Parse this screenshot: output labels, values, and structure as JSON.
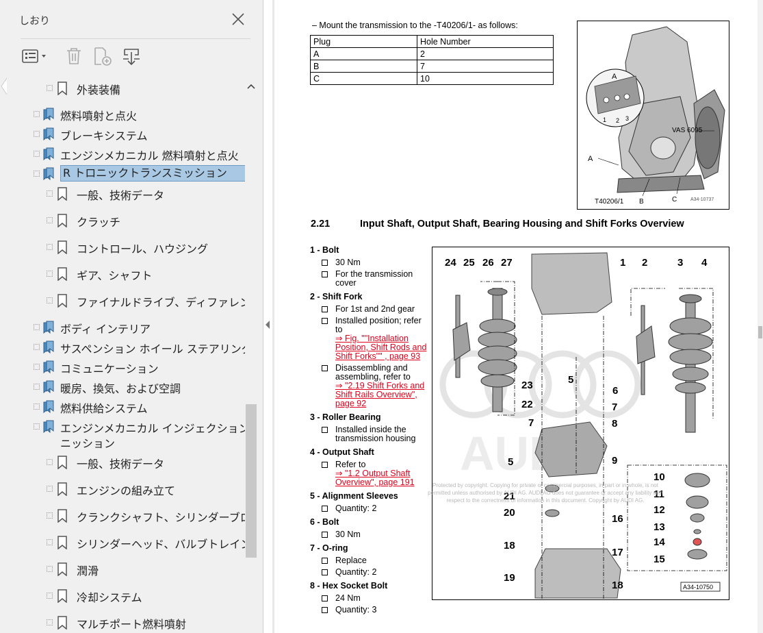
{
  "panel": {
    "title": "しおり",
    "toolbar": [
      "options",
      "delete",
      "new-bookmark",
      "expand"
    ],
    "tree": [
      {
        "label": "外装装備",
        "level": 2,
        "icon": "bookmark"
      },
      {
        "label": "燃料噴射と点火",
        "level": 1,
        "icon": "bookmarks"
      },
      {
        "label": "ブレーキシステム",
        "level": 1,
        "icon": "bookmarks"
      },
      {
        "label": "エンジンメカニカル 燃料噴射と点火",
        "level": 1,
        "icon": "bookmarks"
      },
      {
        "label": "R トロニックトランスミッション",
        "level": 1,
        "icon": "bookmarks",
        "selected": true
      },
      {
        "label": "一般、技術データ",
        "level": 2,
        "icon": "bookmark"
      },
      {
        "label": "クラッチ",
        "level": 2,
        "icon": "bookmark"
      },
      {
        "label": "コントロール、ハウジング",
        "level": 2,
        "icon": "bookmark"
      },
      {
        "label": "ギア、シャフト",
        "level": 2,
        "icon": "bookmark"
      },
      {
        "label": "ファイナルドライブ、ディファレンシャル",
        "level": 2,
        "icon": "bookmark"
      },
      {
        "label": "ボディ インテリア",
        "level": 1,
        "icon": "bookmarks"
      },
      {
        "label": "サスペンション ホイール ステアリング",
        "level": 1,
        "icon": "bookmarks"
      },
      {
        "label": "コミュニケーション",
        "level": 1,
        "icon": "bookmarks"
      },
      {
        "label": "暖房、換気、および空調",
        "level": 1,
        "icon": "bookmarks"
      },
      {
        "label": "燃料供給システム",
        "level": 1,
        "icon": "bookmarks"
      },
      {
        "label": "エンジンメカニカル インジェクション イグ",
        "label2": "ニッション",
        "level": 1,
        "icon": "bookmarks"
      },
      {
        "label": "一般、技術データ",
        "level": 2,
        "icon": "bookmark"
      },
      {
        "label": "エンジンの組み立て",
        "level": 2,
        "icon": "bookmark"
      },
      {
        "label": "クランクシャフト、シリンダーブロック",
        "level": 2,
        "icon": "bookmark"
      },
      {
        "label": "シリンダーヘッド、バルブトレイン",
        "level": 2,
        "icon": "bookmark"
      },
      {
        "label": "潤滑",
        "level": 2,
        "icon": "bookmark"
      },
      {
        "label": "冷却システム",
        "level": 2,
        "icon": "bookmark"
      },
      {
        "label": "マルチポート燃料噴射",
        "level": 2,
        "icon": "bookmark"
      }
    ]
  },
  "doc": {
    "intro": "–   Mount the transmission to the -T40206/1- as follows:",
    "plug_table": {
      "headers": [
        "Plug",
        "Hole Number"
      ],
      "rows": [
        [
          "A",
          "2"
        ],
        [
          "B",
          "7"
        ],
        [
          "C",
          "10"
        ]
      ]
    },
    "fig1": {
      "labels": [
        "A",
        "1",
        "2",
        "3",
        "VAS 6095",
        "A",
        "T40206/1",
        "B",
        "C",
        "A34-10737"
      ]
    },
    "section_number": "2.21",
    "section_title": "Input Shaft, Output Shaft, Bearing Housing and Shift Forks Overview",
    "legend": [
      {
        "title": "1 - Bolt",
        "bullets": [
          {
            "text": "30 Nm"
          },
          {
            "text": "For the transmission cover"
          }
        ]
      },
      {
        "title": "2 - Shift Fork",
        "bullets": [
          {
            "text": "For 1st and 2nd gear"
          },
          {
            "text": "Installed position; refer to",
            "link": "⇒ Fig. \"\"Installation Position, Shift Rods and Shift Forks\"\" , page 93"
          },
          {
            "text": "Disassembling and assembling, refer to",
            "link": "⇒ \"2.19 Shift Forks and Shift Rails Overview\", page 92"
          }
        ]
      },
      {
        "title": "3 - Roller Bearing",
        "bullets": [
          {
            "text": "Installed inside the transmission housing"
          }
        ]
      },
      {
        "title": "4 - Output Shaft",
        "bullets": [
          {
            "text": "Refer to",
            "link": "⇒ \"1.2 Output Shaft Overview\", page 191"
          }
        ]
      },
      {
        "title": "5 - Alignment Sleeves",
        "bullets": [
          {
            "text": "Quantity: 2"
          }
        ]
      },
      {
        "title": "6 - Bolt",
        "bullets": [
          {
            "text": "30 Nm"
          }
        ]
      },
      {
        "title": "7 - O-ring",
        "bullets": [
          {
            "text": "Replace"
          },
          {
            "text": "Quantity: 2"
          }
        ]
      },
      {
        "title": "8 - Hex Socket Bolt",
        "bullets": [
          {
            "text": "24 Nm"
          },
          {
            "text": "Quantity: 3"
          }
        ]
      }
    ],
    "fig2": {
      "callouts": [
        "24",
        "25",
        "26",
        "27",
        "1",
        "2",
        "3",
        "4",
        "23",
        "5",
        "6",
        "22",
        "7",
        "7",
        "8",
        "5",
        "9",
        "10",
        "11",
        "21",
        "12",
        "20",
        "13",
        "16",
        "14",
        "18",
        "17",
        "15",
        "19",
        "18"
      ],
      "brand": "AUDI",
      "figure_id": "A34-10750"
    },
    "watermark": "Protected by copyright. Copying for private or commercial purposes, in part or in whole, is not permitted unless authorised by AUDI AG. AUDI AG does not guarantee or accept any liability with respect to the correctness of information in this document. Copyright by AUDI AG."
  }
}
